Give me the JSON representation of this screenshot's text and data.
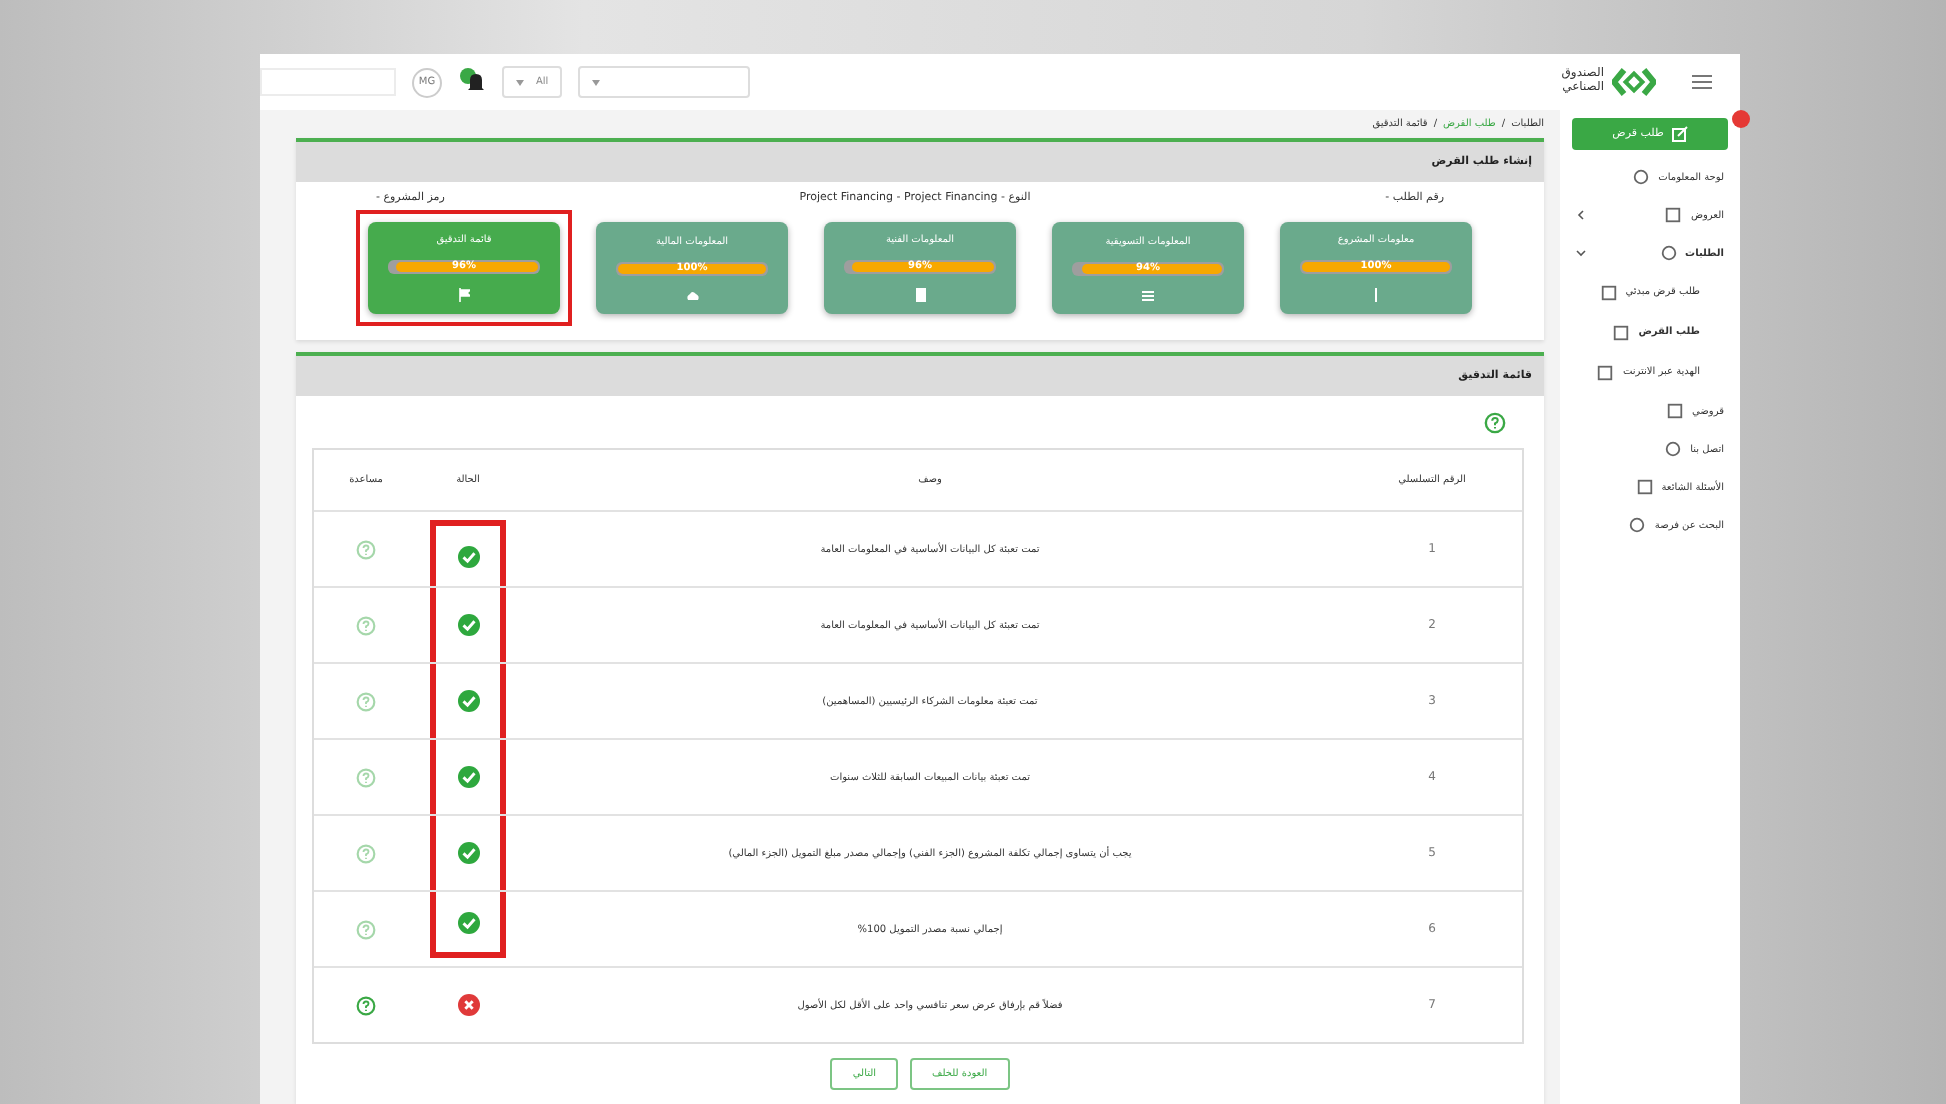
{
  "topbar": {
    "user_initials": "MG",
    "filter_value": "All",
    "logo_text": "الصندوق الصناعي"
  },
  "sidebar": {
    "new_button": "طلب قرض",
    "items": [
      {
        "label": "لوحة المعلومات",
        "selected": false
      },
      {
        "label": "العروض",
        "selected": false,
        "expanded": false
      },
      {
        "label": "الطلبات",
        "selected": false,
        "expanded": true,
        "children": [
          {
            "label": "طلب قرض مبدئي",
            "selected": false
          },
          {
            "label": "طلب القرض",
            "selected": true
          },
          {
            "label": "الهدية عبر الانترنت",
            "selected": false
          }
        ]
      },
      {
        "label": "قروضي",
        "selected": false
      },
      {
        "label": "اتصل بنا",
        "selected": false
      },
      {
        "label": "الأسئلة الشائعة",
        "selected": false
      },
      {
        "label": "البحث عن فرصة",
        "selected": false
      }
    ]
  },
  "breadcrumb": [
    {
      "label": "الطلبات",
      "active": false
    },
    {
      "separator": "/",
      "label": "طلب القرض",
      "active": true
    },
    {
      "separator": "/",
      "label": "قائمة التدقيق",
      "active": false
    }
  ],
  "panel_title": "إنشاء طلب القرض",
  "info": [
    "رقم الطلب -",
    "النوع - Project Financing - Project Financing",
    "رمز المشروع -"
  ],
  "steps": [
    {
      "title": "معلومات المشروع",
      "level": 1,
      "reading": "100%",
      "selected": false,
      "framed": false
    },
    {
      "title": "المعلومات التسويقية",
      "level": 0.94,
      "reading": "94%",
      "selected": false,
      "framed": false
    },
    {
      "title": "المعلومات الفنية",
      "level": 0.96,
      "reading": "96%",
      "selected": false,
      "framed": false
    },
    {
      "title": "المعلومات المالية",
      "level": 1,
      "reading": "100%",
      "selected": false,
      "framed": false
    },
    {
      "title": "قائمة التدقيق",
      "level": 0.96,
      "reading": "96%",
      "selected": true,
      "framed": true
    }
  ],
  "checklist": {
    "title": "قائمة التدقيق",
    "columns": [
      "الرقم التسلسلي",
      "وصف",
      "الحالة",
      "مساعدة"
    ],
    "rows": [
      {
        "number": "1",
        "description": "تمت تعبئة كل البيانات الأساسية في المعلومات العامة",
        "passed": true,
        "framed": true,
        "help_active": false
      },
      {
        "number": "2",
        "description": "تمت تعبئة كل البيانات الأساسية في المعلومات العامة",
        "passed": true,
        "framed": true,
        "help_active": false
      },
      {
        "number": "3",
        "description": "تمت تعبئة معلومات الشركاء الرئيسيين (المساهمين)",
        "passed": true,
        "framed": true,
        "help_active": false
      },
      {
        "number": "4",
        "description": "تمت تعبئة بيانات المبيعات السابقة للثلاث سنوات",
        "passed": true,
        "framed": true,
        "help_active": false
      },
      {
        "number": "5",
        "description": "يجب أن يتساوى إجمالي تكلفة المشروع (الجزء الفني) وإجمالي مصدر مبلغ التمويل (الجزء المالي)",
        "passed": true,
        "framed": true,
        "help_active": false
      },
      {
        "number": "6",
        "description": "إجمالي نسبة مصدر التمويل 100%",
        "passed": true,
        "framed": true,
        "help_active": false
      },
      {
        "number": "7",
        "description": "فضلاً قم بإرفاق عرض سعر تنافسي واحد على الأقل لكل الأصول",
        "passed": false,
        "framed": false,
        "help_active": true
      }
    ]
  },
  "buttons": [
    "العودة للخلف",
    "التالي"
  ]
}
